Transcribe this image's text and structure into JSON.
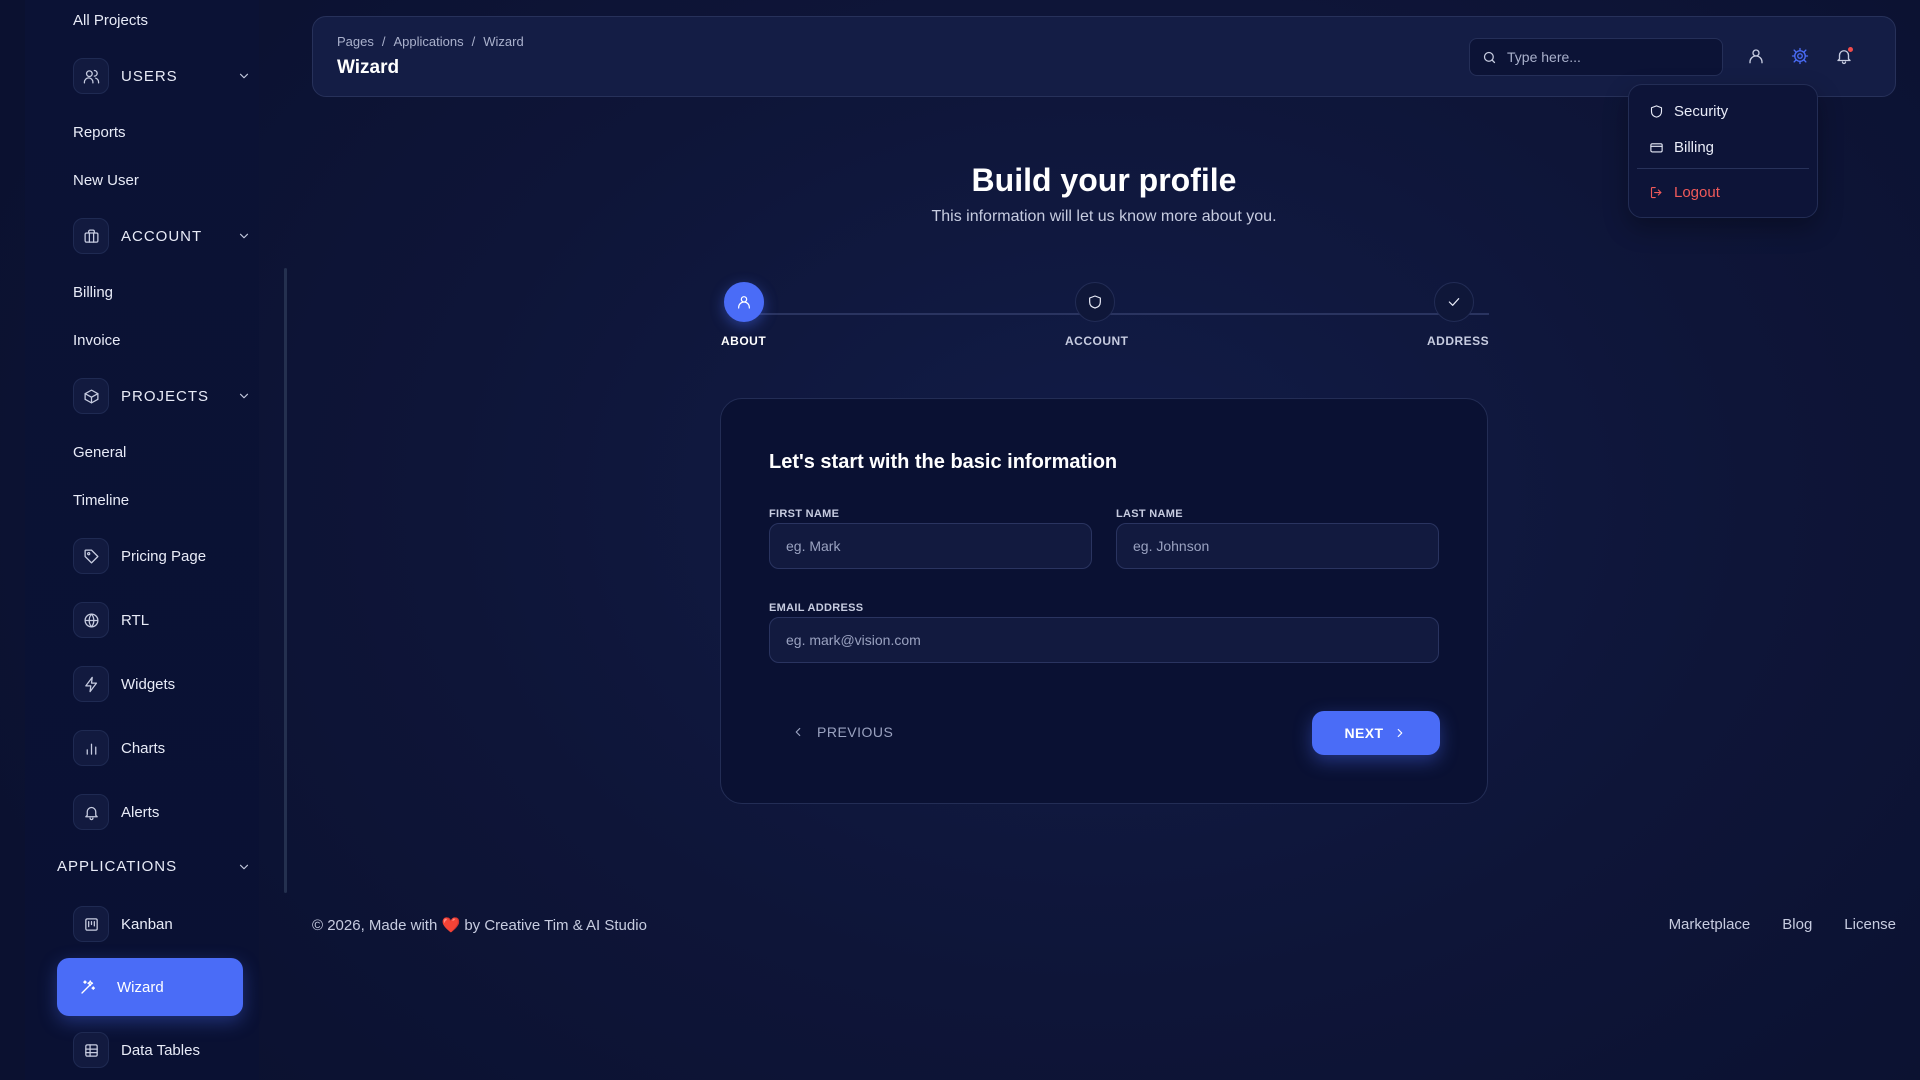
{
  "sidebar": {
    "all_projects": "All Projects",
    "users": "USERS",
    "reports": "Reports",
    "new_user": "New User",
    "account": "ACCOUNT",
    "billing": "Billing",
    "invoice": "Invoice",
    "projects": "PROJECTS",
    "general": "General",
    "timeline": "Timeline",
    "pricing_page": "Pricing Page",
    "rtl": "RTL",
    "widgets": "Widgets",
    "charts": "Charts",
    "alerts": "Alerts",
    "applications": "APPLICATIONS",
    "kanban": "Kanban",
    "wizard": "Wizard",
    "data_tables": "Data Tables"
  },
  "header": {
    "breadcrumb": [
      "Pages",
      "Applications",
      "Wizard"
    ],
    "separator": "/",
    "title": "Wizard",
    "search_placeholder": "Type here..."
  },
  "dropdown": {
    "security": "Security",
    "billing": "Billing",
    "logout": "Logout"
  },
  "main": {
    "title": "Build your profile",
    "subtitle": "This information will let us know more about you."
  },
  "stepper": {
    "steps": [
      "ABOUT",
      "ACCOUNT",
      "ADDRESS"
    ],
    "active_index": 0
  },
  "form": {
    "title": "Let's start with the basic information",
    "first_name_label": "FIRST NAME",
    "first_name_placeholder": "eg. Mark",
    "last_name_label": "LAST NAME",
    "last_name_placeholder": "eg. Johnson",
    "email_label": "EMAIL ADDRESS",
    "email_placeholder": "eg. mark@vision.com",
    "previous": "PREVIOUS",
    "next": "NEXT"
  },
  "footer": {
    "copyright_prefix": "© 2026, Made with",
    "heart": "❤️",
    "copyright_suffix": "by Creative Tim & AI Studio",
    "links": [
      "Marketplace",
      "Blog",
      "License"
    ]
  },
  "colors": {
    "background": "#0e1538",
    "accent": "#4a6cf7",
    "logout": "#f05a5a",
    "notification": "#f04b4b"
  }
}
